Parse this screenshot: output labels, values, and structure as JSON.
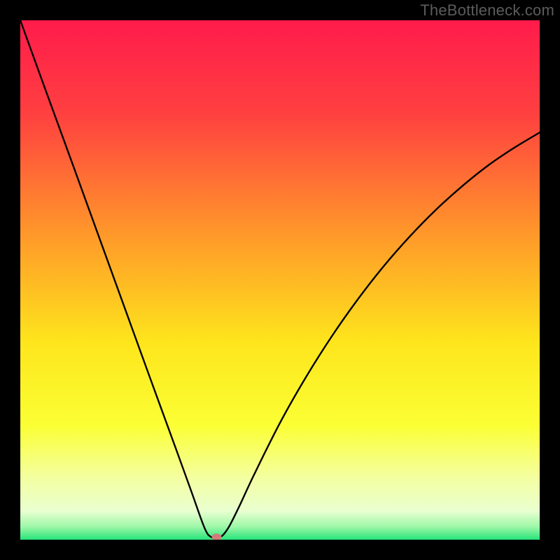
{
  "watermark": "TheBottleneck.com",
  "chart_data": {
    "type": "line",
    "title": "",
    "xlabel": "",
    "ylabel": "",
    "xlim": [
      0,
      100
    ],
    "ylim": [
      0,
      100
    ],
    "grid": false,
    "legend": false,
    "background_gradient_stops": [
      {
        "offset": 0.0,
        "color": "#ff1b4b"
      },
      {
        "offset": 0.18,
        "color": "#ff4040"
      },
      {
        "offset": 0.42,
        "color": "#ff9b29"
      },
      {
        "offset": 0.62,
        "color": "#fee51c"
      },
      {
        "offset": 0.78,
        "color": "#fbff34"
      },
      {
        "offset": 0.88,
        "color": "#f4ffa0"
      },
      {
        "offset": 0.945,
        "color": "#e9ffd0"
      },
      {
        "offset": 0.975,
        "color": "#9df7a8"
      },
      {
        "offset": 1.0,
        "color": "#26e57a"
      }
    ],
    "series": [
      {
        "name": "bottleneck-curve",
        "x": [
          0,
          5,
          10,
          15,
          20,
          25,
          30,
          33,
          35.5,
          36.8,
          38.5,
          40,
          42,
          45,
          50,
          55,
          60,
          65,
          70,
          75,
          80,
          85,
          90,
          95,
          100
        ],
        "y": [
          100,
          86.2,
          72.5,
          58.7,
          44.9,
          31.1,
          17.4,
          9.1,
          2.2,
          0.5,
          0.5,
          2.2,
          6.1,
          12.5,
          22.5,
          31.3,
          39.2,
          46.3,
          52.7,
          58.4,
          63.5,
          68.0,
          72.0,
          75.4,
          78.4
        ]
      }
    ],
    "marker": {
      "x": 37.8,
      "y": 0.5,
      "color": "#cf7b7b",
      "rx": 7,
      "ry": 5
    }
  }
}
